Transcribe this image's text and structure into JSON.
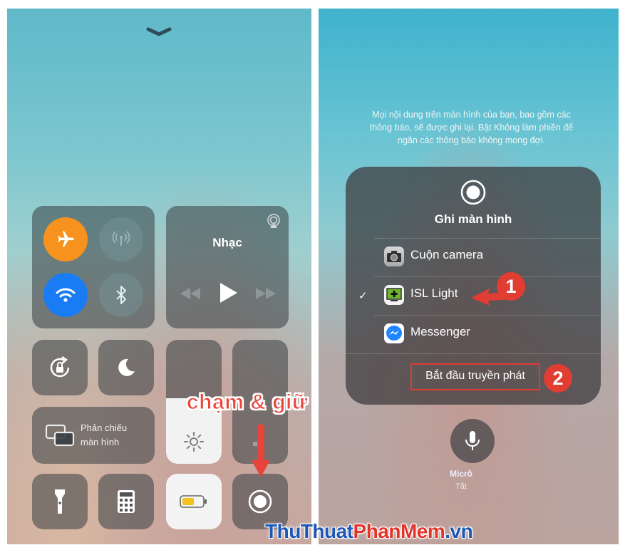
{
  "left_panel": {
    "music": {
      "title": "Nhạc"
    },
    "screen_mirroring": {
      "label_line1": "Phản chiếu",
      "label_line2": "màn hình"
    },
    "annotation": "chạm & giữ",
    "colors": {
      "airplane": "#f7921e",
      "wifi": "#1a7cf5",
      "tile": "#3a3f43",
      "annotation": "#e8443a"
    }
  },
  "right_panel": {
    "info_text": "Mọi nội dung trên màn hình của bạn, bao gồm các thông báo, sẽ được ghi lại. Bật Không làm phiền để ngăn các thông báo không mong đợi.",
    "popup": {
      "title": "Ghi màn hình",
      "apps": [
        {
          "label": "Cuộn camera",
          "icon": "camera-icon",
          "selected": false
        },
        {
          "label": "ISL Light",
          "icon": "isl-light-icon",
          "selected": true
        },
        {
          "label": "Messenger",
          "icon": "messenger-icon",
          "selected": false
        }
      ],
      "checkmark": "✓",
      "start_button": "Bắt đầu truyền phát"
    },
    "badges": [
      "1",
      "2"
    ],
    "mic": {
      "label": "Micrô",
      "status": "Tắt"
    }
  },
  "watermark": {
    "part1": "ThuThuat",
    "part2": "PhanMem",
    "part3": ".vn"
  }
}
